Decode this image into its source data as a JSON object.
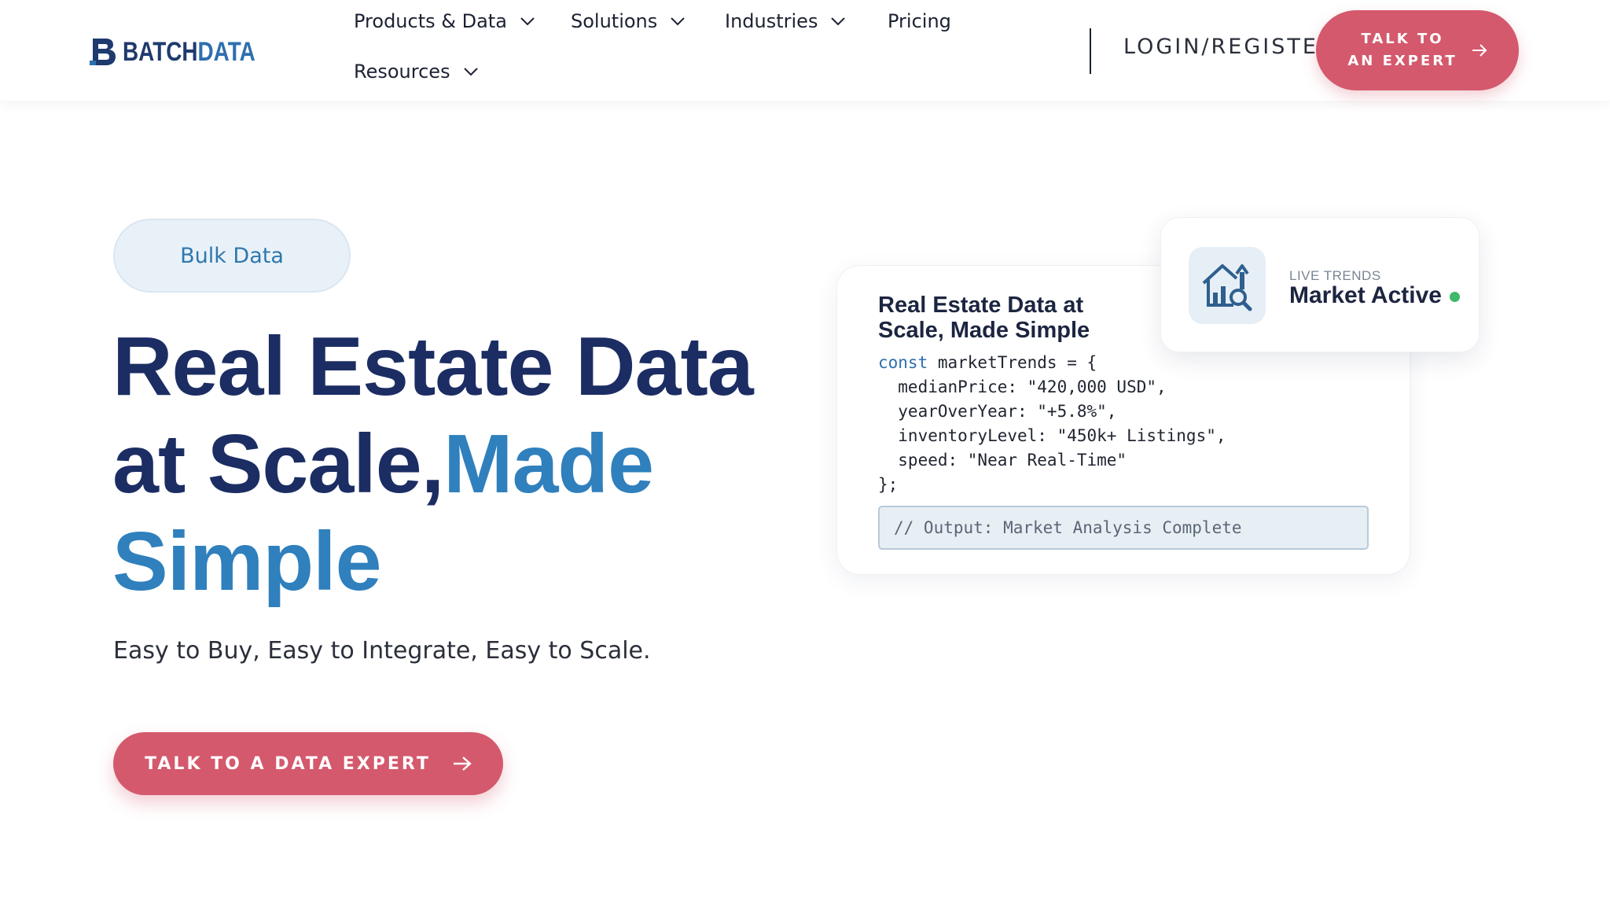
{
  "brand": {
    "logo_text_main": "BATCH",
    "logo_text_accent": "DATA",
    "colors": {
      "navy": "#1f3a6e",
      "blue": "#2e6fae",
      "cta": "#d4596c"
    }
  },
  "nav": {
    "items": [
      {
        "label": "Products & Data",
        "has_dropdown": true
      },
      {
        "label": "Solutions",
        "has_dropdown": true
      },
      {
        "label": "Industries",
        "has_dropdown": true
      },
      {
        "label": "Pricing",
        "has_dropdown": false
      },
      {
        "label": "Resources",
        "has_dropdown": true
      }
    ],
    "login_label": "LOGIN/REGISTER",
    "cta_label": "TALK TO AN EXPERT"
  },
  "hero": {
    "badge": "Bulk Data",
    "headline_line1": "Real Estate Data",
    "headline_line2_part1": "at Scale,",
    "headline_accent_1": "Made",
    "headline_accent_2": "Simple",
    "subheadline": "Easy to Buy, Easy to Integrate, Easy to Scale.",
    "cta_label": "TALK TO A DATA EXPERT"
  },
  "code_card": {
    "title": "Real Estate Data at Scale, Made Simple",
    "keyword": "const",
    "line1_rest": " marketTrends = {",
    "line2": "  medianPrice: \"420,000 USD\",",
    "line3": "  yearOverYear: \"+5.8%\",",
    "line4": "  inventoryLevel: \"450k+ Listings\",",
    "line5": "  speed: \"Near Real-Time\"",
    "line6": "};",
    "output": "// Output: Market Analysis Complete"
  },
  "trend_card": {
    "label": "LIVE TRENDS",
    "status": "Market Active",
    "icon": "house-chart-search-icon",
    "status_color": "#3fb86a"
  }
}
